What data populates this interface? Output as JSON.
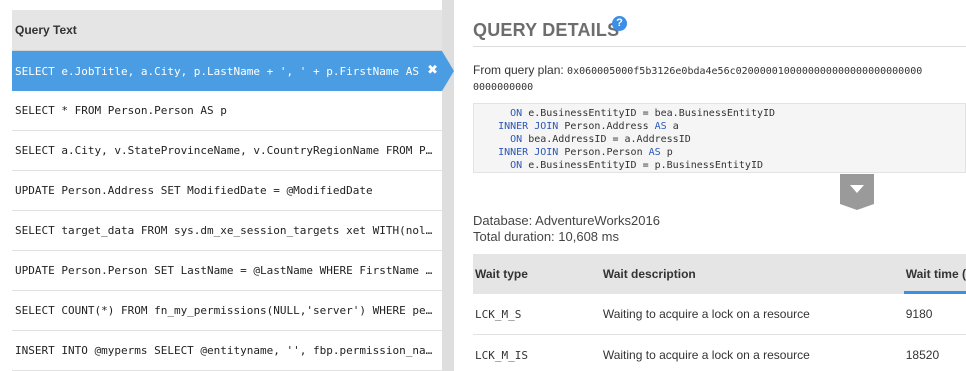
{
  "query_list": {
    "header": "Query Text",
    "items": [
      "SELECT e.JobTitle, a.City, p.LastName + ', ' + p.FirstName AS EmployeeName",
      "SELECT * FROM Person.Person AS p",
      "SELECT a.City, v.StateProvinceName, v.CountryRegionName FROM Person.Address",
      "UPDATE Person.Address SET ModifiedDate = @ModifiedDate",
      "SELECT target_data FROM sys.dm_xe_session_targets xet WITH(nolock)",
      "UPDATE Person.Person SET LastName = @LastName WHERE FirstName = @FirstName",
      "SELECT COUNT(*) FROM fn_my_permissions(NULL,'server') WHERE permission_name",
      "INSERT INTO @myperms SELECT @entityname, '', fbp.permission_name FROM"
    ],
    "selected_index": 0
  },
  "details": {
    "title": "QUERY DETAILS",
    "help_label": "?",
    "plan_label": "From query plan:",
    "plan_hash": "0x060005000f5b3126e0bda4e56c0200000100000000000000000000000",
    "plan_hash_cont": "0000000000",
    "code_lines": [
      {
        "pre": "      ",
        "kw": "ON",
        "rest": " e.BusinessEntityID = bea.BusinessEntityID"
      },
      {
        "pre": "    ",
        "kw": "INNER JOIN",
        "rest": " Person.Address ",
        "kw2": "AS",
        "rest2": " a"
      },
      {
        "pre": "      ",
        "kw": "ON",
        "rest": " bea.AddressID = a.AddressID"
      },
      {
        "pre": "    ",
        "kw": "INNER JOIN",
        "rest": " Person.Person ",
        "kw2": "AS",
        "rest2": " p"
      },
      {
        "pre": "      ",
        "kw": "ON",
        "rest": " e.BusinessEntityID = p.BusinessEntityID"
      }
    ],
    "database": "Database: AdventureWorks2016",
    "duration": "Total duration: 10,608 ms"
  },
  "wait_table": {
    "headers": [
      "Wait type",
      "Wait description",
      "Wait time ("
    ],
    "rows": [
      [
        "LCK_M_S",
        "Waiting to acquire a lock on a resource",
        "9180"
      ],
      [
        "LCK_M_IS",
        "Waiting to acquire a lock on a resource",
        "18520"
      ]
    ]
  },
  "colors": {
    "accent": "#4a9de3",
    "help": "#3d8fe6",
    "keyword": "#2b57b8"
  }
}
